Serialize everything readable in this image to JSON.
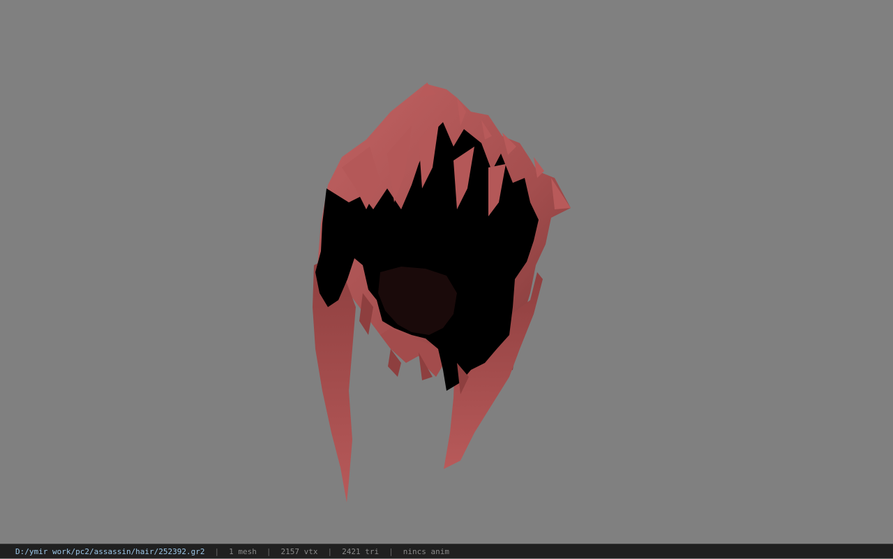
{
  "viewer": {
    "background_color": "#808080",
    "model_colors": {
      "hair_lit": "#b85a5a",
      "hair_mid": "#9a4646",
      "hair_dark": "#5e2a2a",
      "shadow": "#000000"
    }
  },
  "status": {
    "file_path": "D:/ymir work/pc2/assassin/hair/252392.gr2",
    "separator": "|",
    "mesh_count": "1 mesh",
    "vertex_count": "2157 vtx",
    "triangle_count": "2421 tri",
    "anim_status": "nincs anim"
  }
}
